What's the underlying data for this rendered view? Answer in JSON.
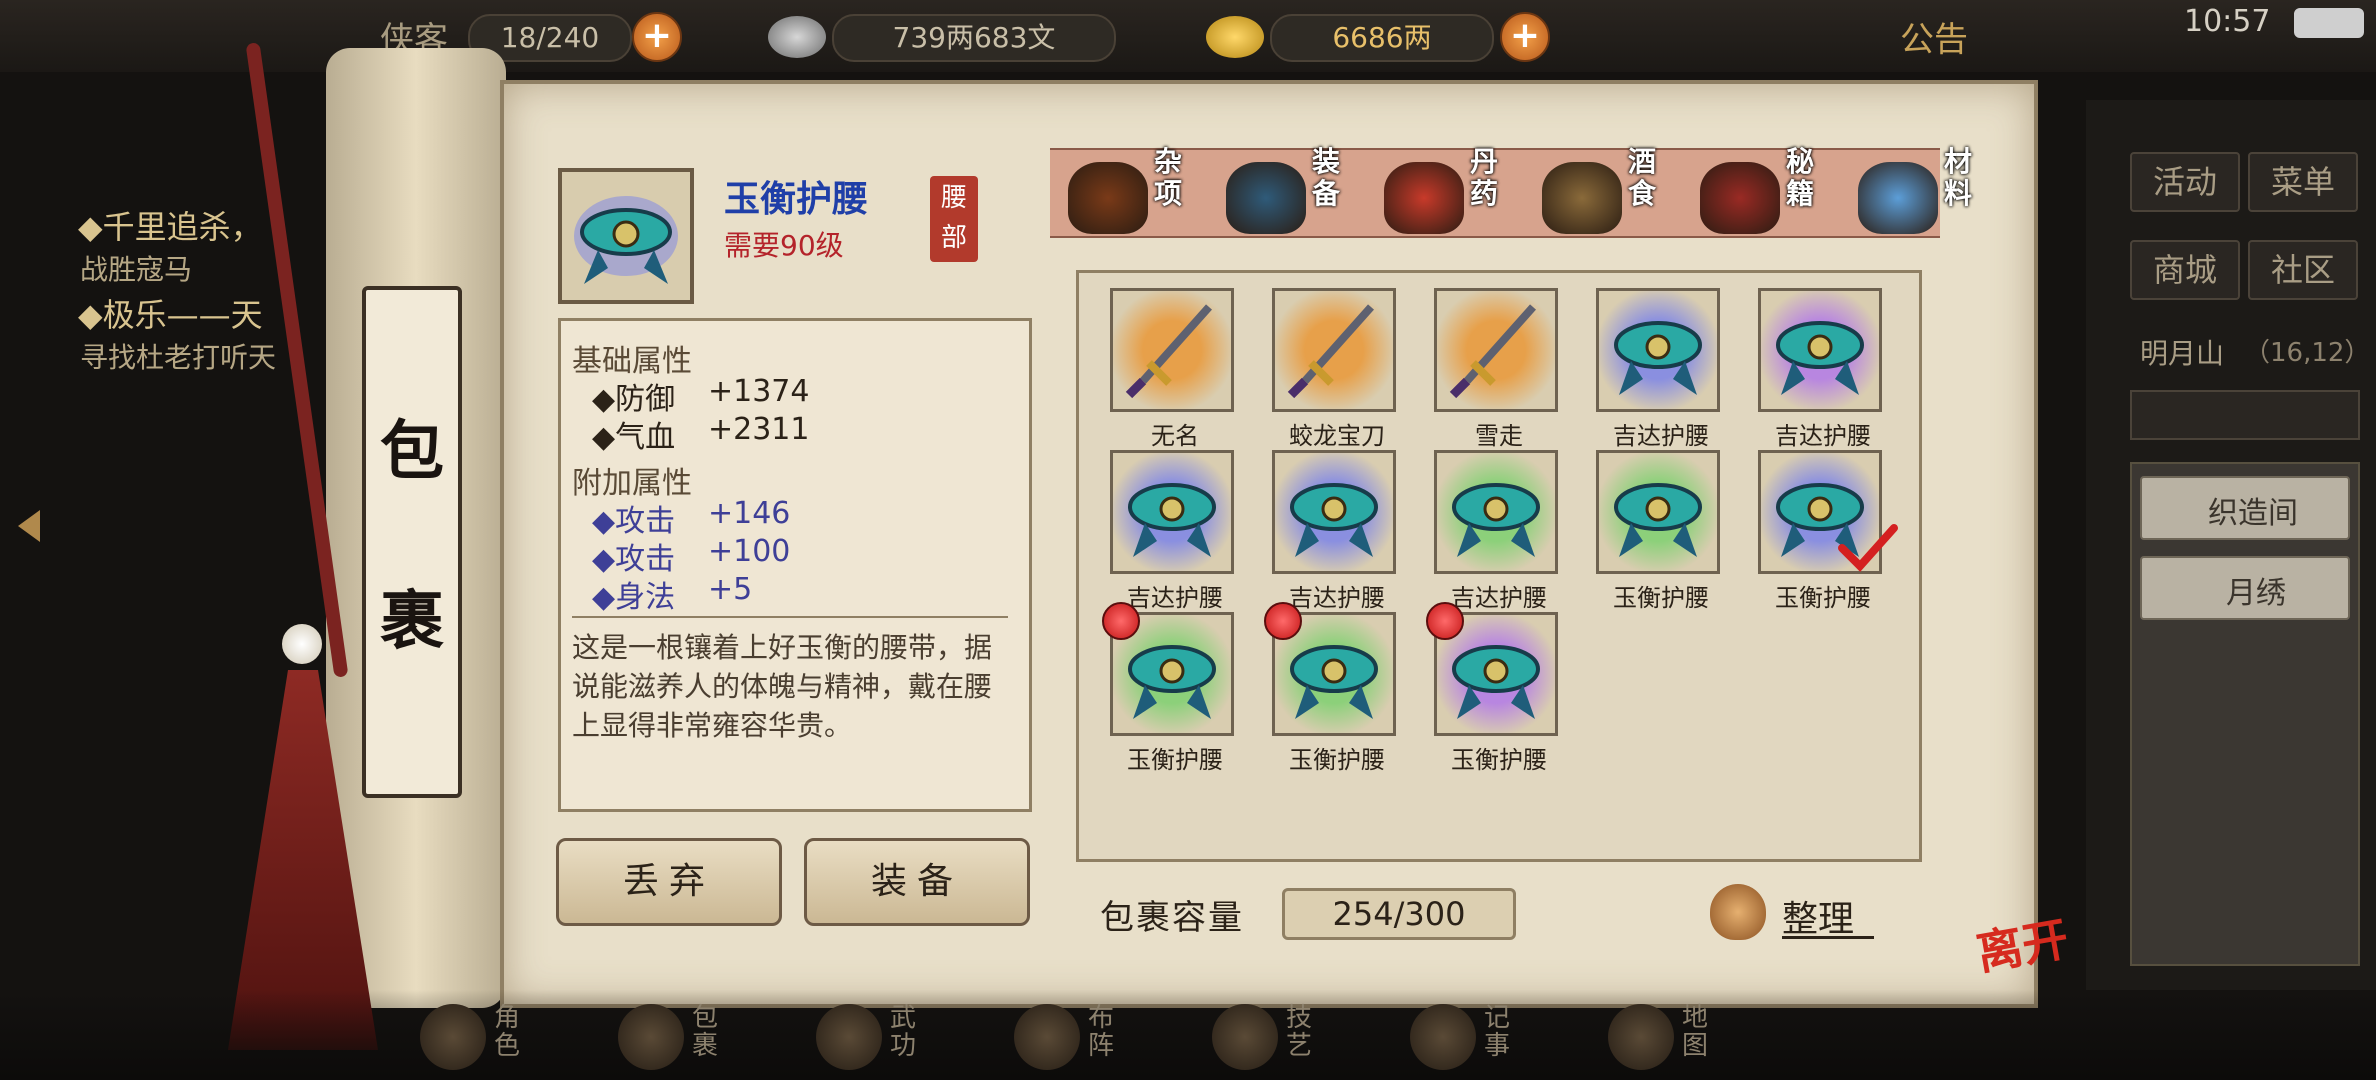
{
  "topbar": {
    "bag_label": "侠客",
    "bag_count": "18/240",
    "silver": "739两683文",
    "gold": "6686两",
    "announce": "公告",
    "time": "10:57"
  },
  "quests": [
    {
      "title": "◆千里追杀，",
      "detail": "战胜寇马"
    },
    {
      "title": "◆极乐——天",
      "detail": "寻找杜老打听天"
    }
  ],
  "side_menu": {
    "activity": "活动",
    "menu": "菜单",
    "shop": "商城",
    "community": "社区",
    "location": "明月山",
    "coords": "（16,12）",
    "weaving": "织造间",
    "embroidery": "月绣"
  },
  "scroll": {
    "char1": "包",
    "char2": "裹"
  },
  "item": {
    "name": "玉衡护腰",
    "requirement": "需要90级",
    "slot": "腰部",
    "basic_title": "基础属性",
    "basic": [
      {
        "label": "◆防御",
        "value": "+1374"
      },
      {
        "label": "◆气血",
        "value": "+2311"
      }
    ],
    "extra_title": "附加属性",
    "extra": [
      {
        "label": "◆攻击",
        "value": "+146"
      },
      {
        "label": "◆攻击",
        "value": "+100"
      },
      {
        "label": "◆身法",
        "value": "+5"
      }
    ],
    "description": "这是一根镶着上好玉衡的腰带，据说能滋养人的体魄与精神，戴在腰上显得非常雍容华贵。"
  },
  "buttons": {
    "discard": "丢弃",
    "equip": "装备",
    "organize": "整理",
    "leave": "离开"
  },
  "tabs": [
    {
      "label": "杂项",
      "icon": "jar-icon"
    },
    {
      "label": "装备",
      "icon": "equipment-icon"
    },
    {
      "label": "丹药",
      "icon": "pill-icon"
    },
    {
      "label": "酒食",
      "icon": "food-icon"
    },
    {
      "label": "秘籍",
      "icon": "book-icon"
    },
    {
      "label": "材料",
      "icon": "crystal-icon"
    }
  ],
  "inventory": [
    {
      "name": "无名",
      "icon": "sword-icon",
      "bg": "#e7a04a",
      "badge": false,
      "check": false
    },
    {
      "name": "蛟龙宝刀",
      "icon": "sword-icon",
      "bg": "#e7a04a",
      "badge": false,
      "check": false
    },
    {
      "name": "雪走",
      "icon": "katana-icon",
      "bg": "#e7a04a",
      "badge": false,
      "check": false
    },
    {
      "name": "吉达护腰",
      "icon": "belt-icon",
      "bg": "#8a8fe0",
      "badge": false,
      "check": false
    },
    {
      "name": "吉达护腰",
      "icon": "belt-icon",
      "bg": "#b886e0",
      "badge": false,
      "check": false
    },
    {
      "name": "吉达护腰",
      "icon": "belt-icon",
      "bg": "#8a8fe0",
      "badge": false,
      "check": false
    },
    {
      "name": "吉达护腰",
      "icon": "belt-icon",
      "bg": "#8a8fe0",
      "badge": false,
      "check": false
    },
    {
      "name": "吉达护腰",
      "icon": "belt-icon",
      "bg": "#8cd07a",
      "badge": false,
      "check": false
    },
    {
      "name": "玉衡护腰",
      "icon": "belt-icon",
      "bg": "#8cd07a",
      "badge": false,
      "check": false
    },
    {
      "name": "玉衡护腰",
      "icon": "belt-icon",
      "bg": "#8a8fe0",
      "badge": false,
      "check": true
    },
    {
      "name": "玉衡护腰",
      "icon": "belt-icon",
      "bg": "#8cd07a",
      "badge": true,
      "check": false
    },
    {
      "name": "玉衡护腰",
      "icon": "belt-icon",
      "bg": "#8cd07a",
      "badge": true,
      "check": false
    },
    {
      "name": "玉衡护腰",
      "icon": "belt-icon",
      "bg": "#b886e0",
      "badge": true,
      "check": false
    }
  ],
  "capacity": {
    "label": "包裹容量",
    "value": "254/300"
  },
  "bottom_nav": [
    "角色",
    "包裹",
    "武功",
    "布阵",
    "技艺",
    "记事",
    "地图"
  ],
  "colors": {
    "accent_blue": "#1f3fa8",
    "requirement_red": "#b4232a",
    "attr_blue": "#3e3f97"
  }
}
